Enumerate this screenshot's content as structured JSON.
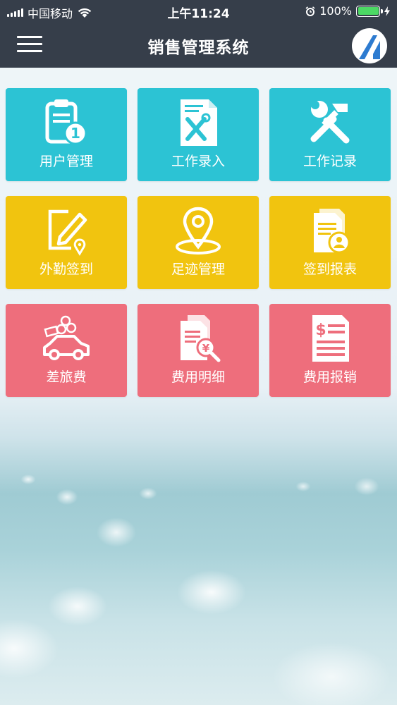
{
  "status_bar": {
    "carrier": "中国移动",
    "time": "上午11:24",
    "battery_percent": "100%",
    "battery_level": 1.0
  },
  "navbar": {
    "title": "销售管理系统",
    "menu_icon": "hamburger-menu-icon",
    "logo": "company-logo"
  },
  "colors": {
    "bar_bg": "#363e4a",
    "teal": "#2cc3d4",
    "yellow": "#f1c40f",
    "pink": "#ee6e7c"
  },
  "tiles": [
    {
      "label": "用户管理",
      "icon": "clipboard-user-icon",
      "color": "teal"
    },
    {
      "label": "工作录入",
      "icon": "document-tools-icon",
      "color": "teal"
    },
    {
      "label": "工作记录",
      "icon": "wrench-hammer-icon",
      "color": "teal"
    },
    {
      "label": "外勤签到",
      "icon": "edit-location-icon",
      "color": "yellow"
    },
    {
      "label": "足迹管理",
      "icon": "map-pin-icon",
      "color": "yellow"
    },
    {
      "label": "签到报表",
      "icon": "report-user-icon",
      "color": "yellow"
    },
    {
      "label": "差旅费",
      "icon": "car-money-icon",
      "color": "pink"
    },
    {
      "label": "费用明细",
      "icon": "document-yen-search-icon",
      "color": "pink"
    },
    {
      "label": "费用报销",
      "icon": "dollar-document-icon",
      "color": "pink"
    }
  ]
}
